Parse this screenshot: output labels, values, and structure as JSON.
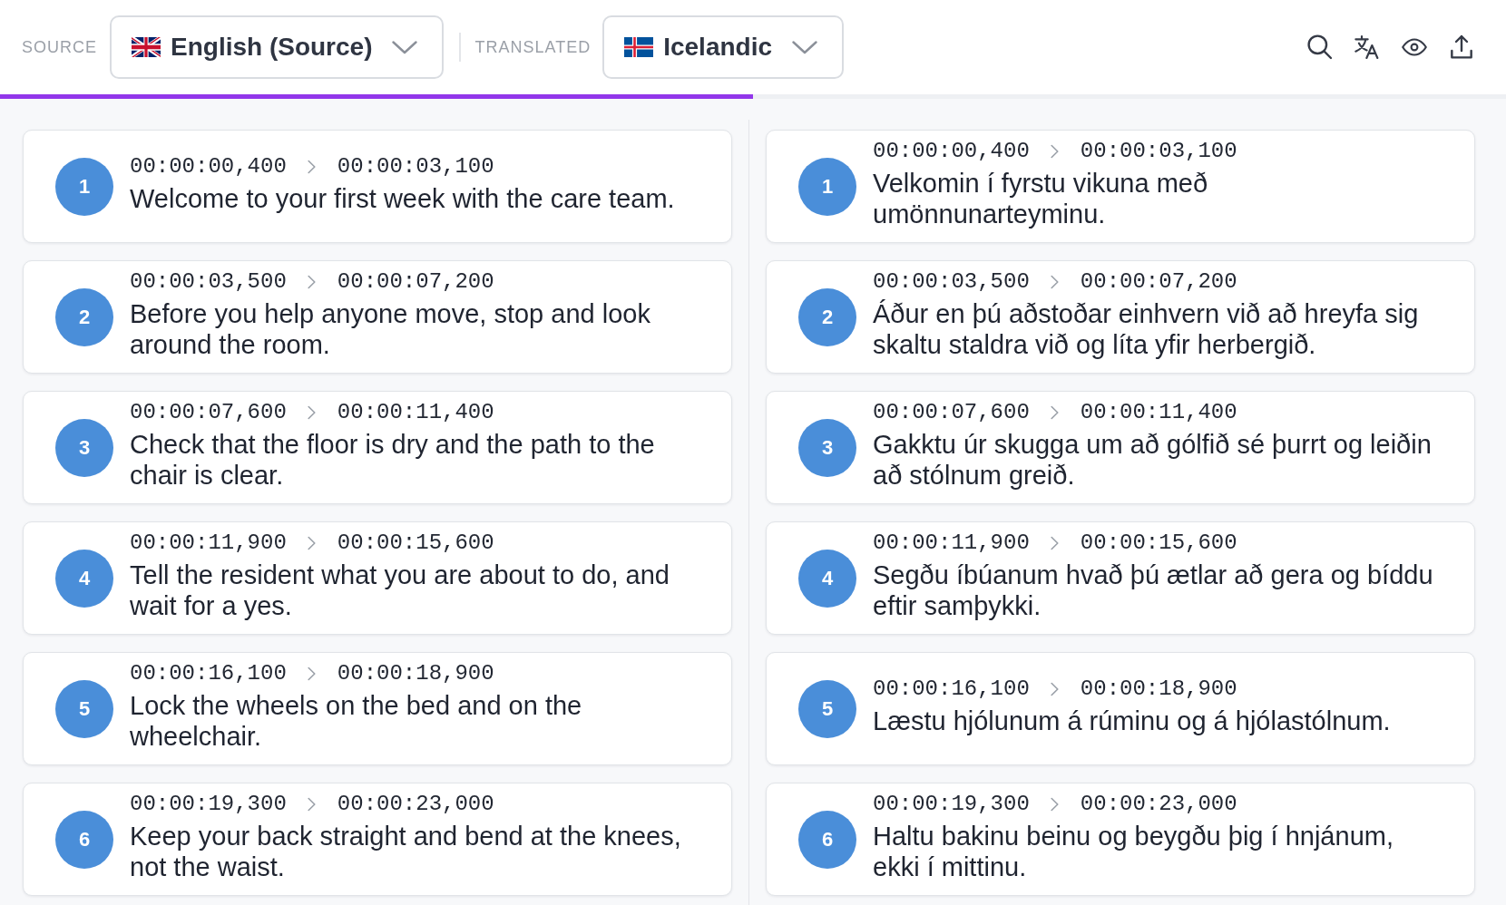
{
  "toolbar": {
    "source_label": "SOURCE",
    "source_language": "English (Source)",
    "translated_label": "TRANSLATED",
    "translated_language": "Icelandic"
  },
  "progress": {
    "level": 0.5
  },
  "source_cues": [
    {
      "number": "1",
      "start": "00:00:00,400",
      "end": "00:00:03,100",
      "text": "Welcome to your first week with the care team."
    },
    {
      "number": "2",
      "start": "00:00:03,500",
      "end": "00:00:07,200",
      "text": "Before you help anyone move, stop and look around the room."
    },
    {
      "number": "3",
      "start": "00:00:07,600",
      "end": "00:00:11,400",
      "text": "Check that the floor is dry and the path to the chair is clear."
    },
    {
      "number": "4",
      "start": "00:00:11,900",
      "end": "00:00:15,600",
      "text": "Tell the resident what you are about to do, and wait for a yes."
    },
    {
      "number": "5",
      "start": "00:00:16,100",
      "end": "00:00:18,900",
      "text": "Lock the wheels on the bed and on the wheelchair."
    },
    {
      "number": "6",
      "start": "00:00:19,300",
      "end": "00:00:23,000",
      "text": "Keep your back straight and bend at the knees, not the waist."
    }
  ],
  "translated_cues": [
    {
      "number": "1",
      "start": "00:00:00,400",
      "end": "00:00:03,100",
      "text": "Velkomin í fyrstu vikuna með umönnunarteyminu."
    },
    {
      "number": "2",
      "start": "00:00:03,500",
      "end": "00:00:07,200",
      "text": "Áður en þú aðstoðar einhvern við að hreyfa sig skaltu staldra við og líta yfir herbergið."
    },
    {
      "number": "3",
      "start": "00:00:07,600",
      "end": "00:00:11,400",
      "text": "Gakktu úr skugga um að gólfið sé þurrt og leiðin að stólnum greið."
    },
    {
      "number": "4",
      "start": "00:00:11,900",
      "end": "00:00:15,600",
      "text": "Segðu íbúanum hvað þú ætlar að gera og bíddu eftir samþykki."
    },
    {
      "number": "5",
      "start": "00:00:16,100",
      "end": "00:00:18,900",
      "text": "Læstu hjólunum á rúminu og á hjólastólnum."
    },
    {
      "number": "6",
      "start": "00:00:19,300",
      "end": "00:00:23,000",
      "text": "Haltu bakinu beinu og beygðu þig í hnjánum, ekki í mittinu."
    }
  ]
}
